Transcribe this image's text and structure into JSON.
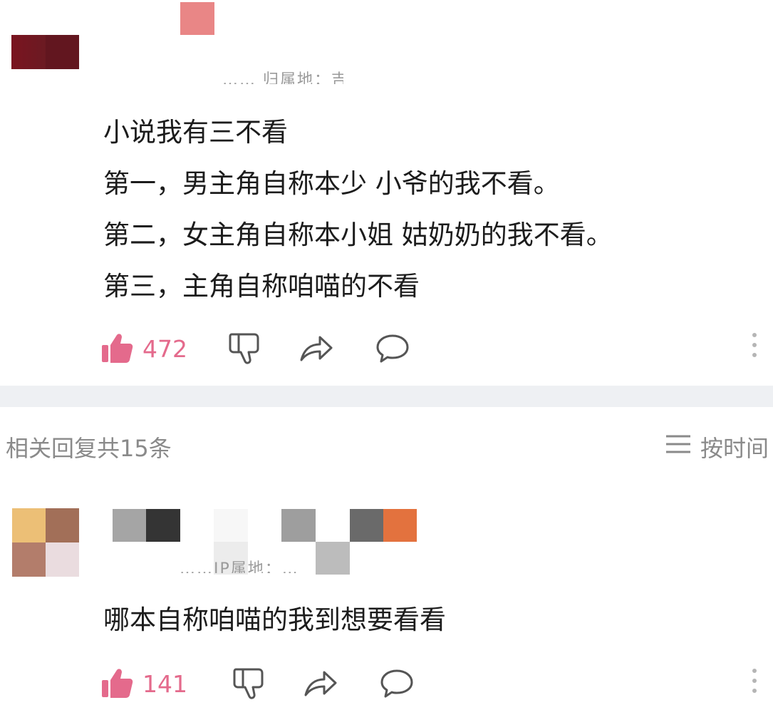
{
  "comment": {
    "meta": "…… 归属地：吉林",
    "lines": [
      "小说我有三不看",
      "第一，男主角自称本少 小爷的我不看。",
      "第二，女主角自称本小姐 姑奶奶的我不看。",
      "第三，主角自称咱喵的不看"
    ],
    "likes": "472"
  },
  "replies_header": {
    "title": "相关回复共15条",
    "sort_label": "按时间"
  },
  "reply": {
    "meta": "……IP属地：…",
    "text": "哪本自称咱喵的我到想要看看",
    "likes": "141"
  },
  "colors": {
    "like_accent": "#e46a8c",
    "icon_gray": "#555555",
    "divider": "#eef0f3"
  },
  "icons": {
    "like": "thumbs-up-icon",
    "dislike": "thumbs-down-icon",
    "share": "share-arrow-icon",
    "comment": "speech-bubble-icon",
    "more": "more-vertical-icon",
    "sort": "menu-lines-icon"
  }
}
